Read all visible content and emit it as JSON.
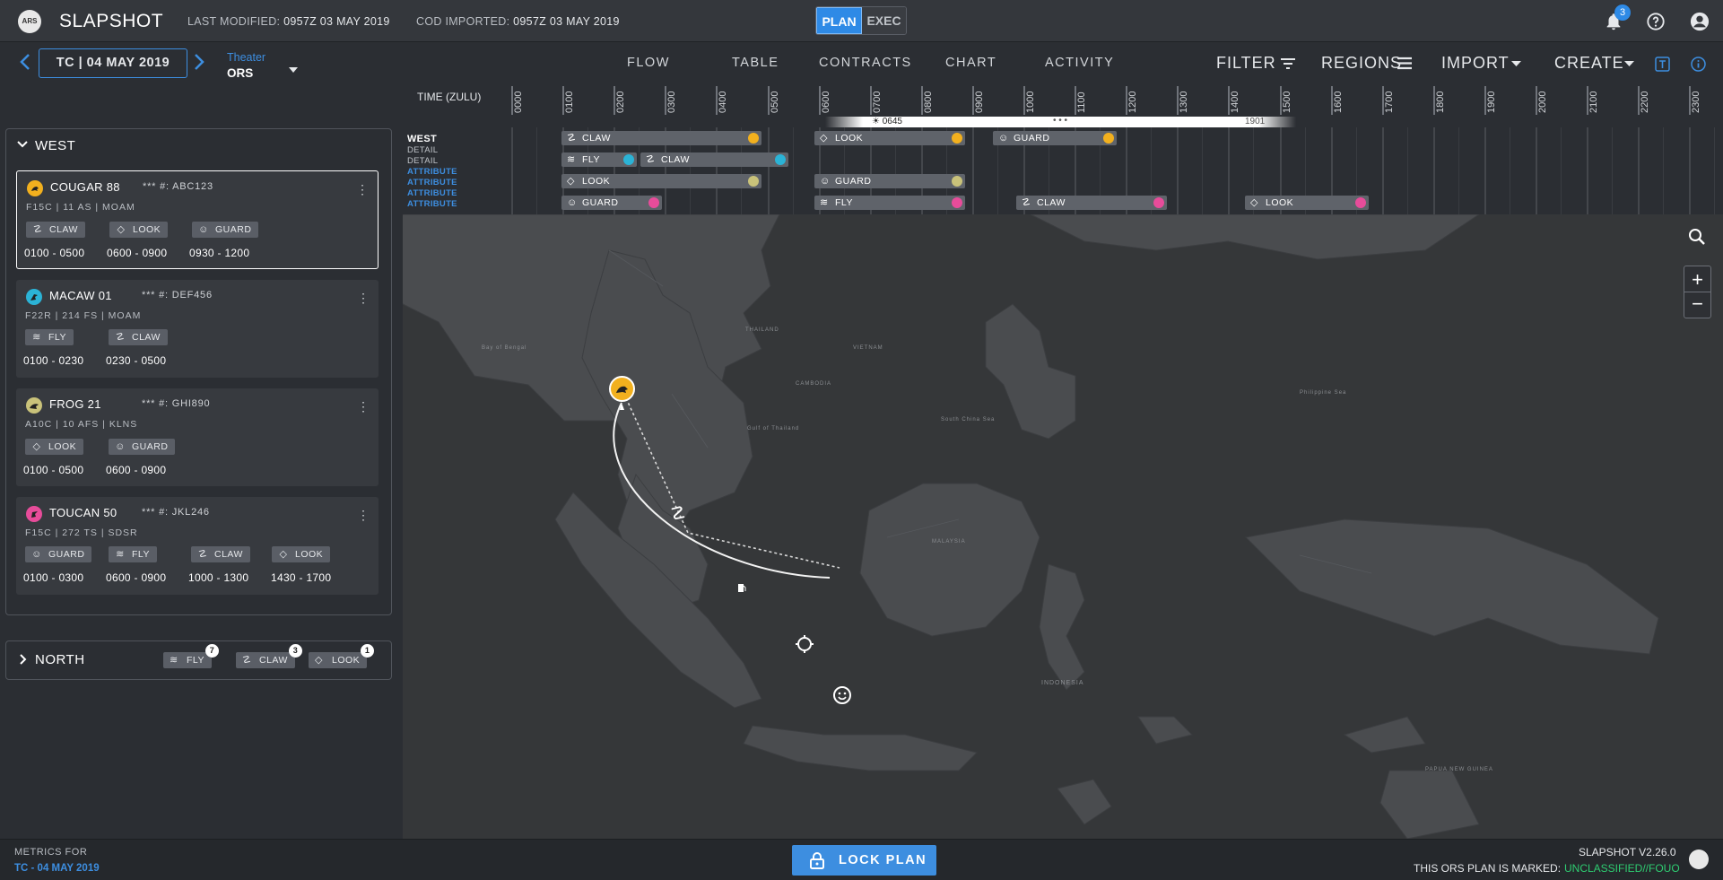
{
  "header": {
    "app_title": "SLAPSHOT",
    "last_modified_label": "LAST MODIFIED:",
    "last_modified_value": "0957Z 03 MAY 2019",
    "cod_imported_label": "COD IMPORTED:",
    "cod_imported_value": "0957Z 03 MAY 2019",
    "mode_plan": "PLAN",
    "mode_exec": "EXEC",
    "notification_count": "3"
  },
  "nav": {
    "date": "TC | 04 MAY 2019",
    "theater_label": "Theater",
    "theater_value": "ORS",
    "tabs": [
      "FLOW",
      "TABLE",
      "CONTRACTS",
      "CHART",
      "ACTIVITY"
    ],
    "tools": {
      "filter": "FILTER",
      "regions": "REGIONS",
      "import": "IMPORT",
      "create": "CREATE"
    }
  },
  "sidebar": {
    "region": "WEST",
    "cards": [
      {
        "name": "COUGAR 88",
        "id": "*** #: ABC123",
        "sub": "F15C | 11 AS | MOAM",
        "color": "#f2b01e",
        "chips": [
          {
            "label": "CLAW",
            "icon": "claw-icon"
          },
          {
            "label": "LOOK",
            "icon": "look-icon"
          },
          {
            "label": "GUARD",
            "icon": "guard-icon"
          }
        ],
        "times": [
          "0100 - 0500",
          "0600 - 0900",
          "0930 - 1200"
        ]
      },
      {
        "name": "MACAW 01",
        "id": "*** #: DEF456",
        "sub": "F22R | 214 FS | MOAM",
        "color": "#2bb3d6",
        "chips": [
          {
            "label": "FLY",
            "icon": "fly-icon"
          },
          {
            "label": "CLAW",
            "icon": "claw-icon"
          }
        ],
        "times": [
          "0100 - 0230",
          "0230 - 0500"
        ]
      },
      {
        "name": "FROG  21",
        "id": "*** #: GHI890",
        "sub": "A10C | 10 AFS | KLNS",
        "color": "#c9c27a",
        "chips": [
          {
            "label": "LOOK",
            "icon": "look-icon"
          },
          {
            "label": "GUARD",
            "icon": "guard-icon"
          }
        ],
        "times": [
          "0100 - 0500",
          "0600 - 0900"
        ]
      },
      {
        "name": "TOUCAN 50",
        "id": "*** #: JKL246",
        "sub": "F15C | 272 TS | SDSR",
        "color": "#e74c9a",
        "chips": [
          {
            "label": "GUARD",
            "icon": "guard-icon"
          },
          {
            "label": "FLY",
            "icon": "fly-icon"
          },
          {
            "label": "CLAW",
            "icon": "claw-icon"
          },
          {
            "label": "LOOK",
            "icon": "look-icon"
          }
        ],
        "times": [
          "0100 - 0300",
          "0600 - 0900",
          "1000 - 1300",
          "1430 - 1700"
        ]
      }
    ],
    "north": {
      "label": "NORTH",
      "chips": [
        {
          "label": "FLY",
          "count": "7"
        },
        {
          "label": "CLAW",
          "count": "3"
        },
        {
          "label": "LOOK",
          "count": "1"
        }
      ]
    }
  },
  "timeline": {
    "time_label": "TIME (ZULU)",
    "hours": [
      "0000",
      "0100",
      "0200",
      "0300",
      "0400",
      "0500",
      "0600",
      "0700",
      "0800",
      "0900",
      "1000",
      "1100",
      "1200",
      "1300",
      "1400",
      "1500",
      "1600",
      "1700",
      "1800",
      "1900",
      "2000",
      "2100",
      "2200",
      "2300"
    ],
    "sunrise": "0645",
    "sunset": "1901",
    "row_labels": [
      "WEST",
      "DETAIL",
      "DETAIL",
      "ATTRIBUTE",
      "ATTRIBUTE",
      "ATTRIBUTE",
      "ATTRIBUTE"
    ],
    "bars": {
      "claw": "CLAW",
      "look": "LOOK",
      "guard": "GUARD",
      "fly": "FLY"
    }
  },
  "map": {
    "labels": [
      "THAILAND",
      "CAMBODIA",
      "VIETNAM",
      "MALAYSIA",
      "INDONESIA",
      "Bay of Bengal",
      "Gulf of Thailand",
      "South China Sea",
      "Philippine Sea",
      "PAPUA NEW GUINEA"
    ]
  },
  "footer": {
    "metrics_label": "METRICS FOR",
    "metrics_value": "TC - 04 MAY 2019",
    "lock_label": "LOCK PLAN",
    "version": "SLAPSHOT V2.26.0",
    "marked_label": "THIS ORS PLAN IS MARKED:",
    "classification": "UNCLASSIFIED//FOUO"
  }
}
